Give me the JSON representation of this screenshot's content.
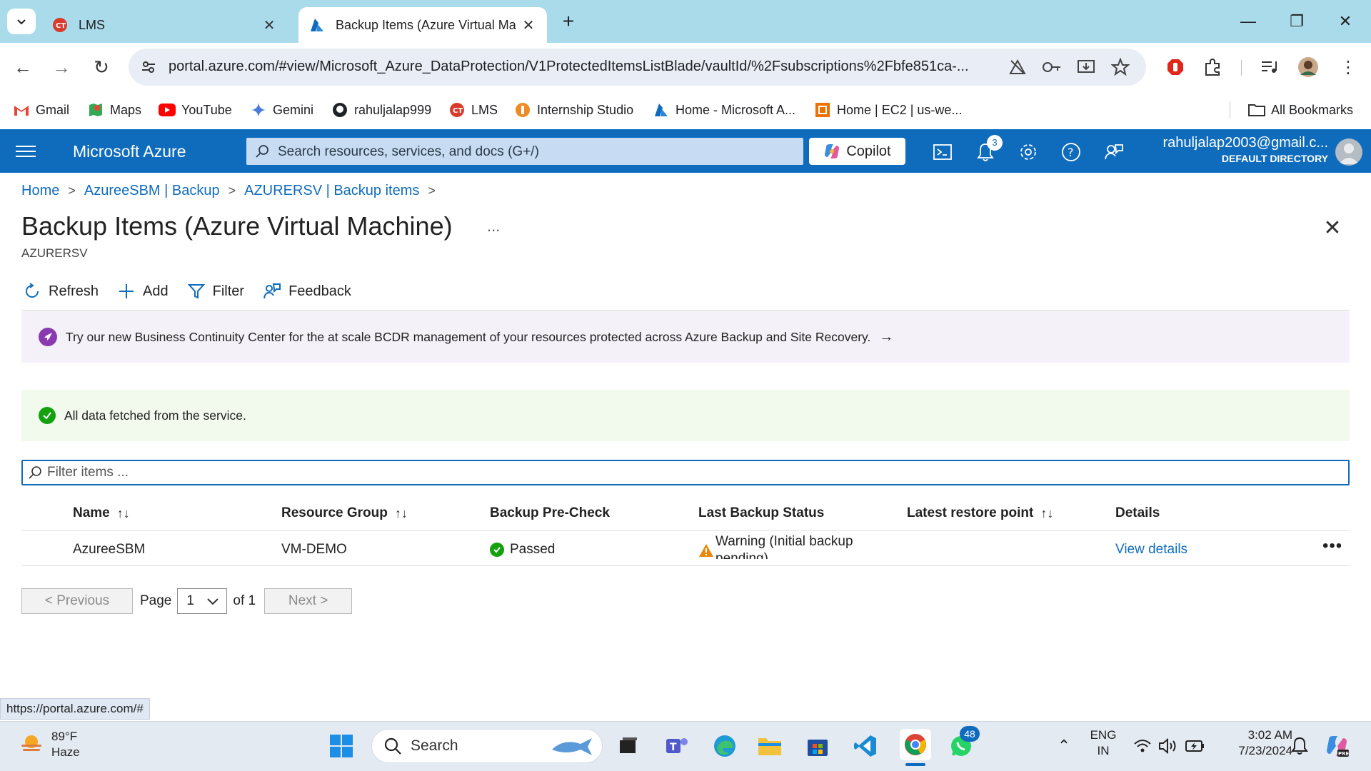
{
  "browser": {
    "tabs": [
      {
        "title": "LMS",
        "active": false
      },
      {
        "title": "Backup Items (Azure Virtual Ma",
        "active": true
      }
    ],
    "url": "portal.azure.com/#view/Microsoft_Azure_DataProtection/V1ProtectedItemsListBlade/vaultId/%2Fsubscriptions%2Fbfe851ca-...",
    "bookmarks": [
      {
        "label": "Gmail"
      },
      {
        "label": "Maps"
      },
      {
        "label": "YouTube"
      },
      {
        "label": "Gemini"
      },
      {
        "label": "rahuljalap999"
      },
      {
        "label": "LMS"
      },
      {
        "label": "Internship Studio"
      },
      {
        "label": "Home - Microsoft A..."
      },
      {
        "label": "Home | EC2 | us-we..."
      }
    ],
    "all_bookmarks": "All Bookmarks",
    "status_url": "https://portal.azure.com/#"
  },
  "azure": {
    "brand": "Microsoft Azure",
    "search_placeholder": "Search resources, services, and docs (G+/)",
    "copilot": "Copilot",
    "notification_count": "3",
    "account_email": "rahuljalap2003@gmail.c...",
    "account_directory": "DEFAULT DIRECTORY"
  },
  "breadcrumb": [
    "Home",
    "AzureeSBM | Backup",
    "AZURERSV | Backup items"
  ],
  "page": {
    "title": "Backup Items (Azure Virtual Machine)",
    "subtitle": "AZURERSV",
    "more": "...",
    "toolbar": {
      "refresh": "Refresh",
      "add": "Add",
      "filter": "Filter",
      "feedback": "Feedback"
    },
    "banner": "Try our new Business Continuity Center for the at scale BCDR management of your resources protected across Azure Backup and Site Recovery.",
    "success_message": "All data fetched from the service.",
    "filter_placeholder": "Filter items ..."
  },
  "table": {
    "columns": [
      "Name",
      "Resource Group",
      "Backup Pre-Check",
      "Last Backup Status",
      "Latest restore point",
      "Details"
    ],
    "rows": [
      {
        "name": "AzureeSBM",
        "resource_group": "VM-DEMO",
        "precheck": "Passed",
        "last_backup_status": "Warning (Initial backup pending)",
        "latest_restore_point": "",
        "details": "View details"
      }
    ]
  },
  "pager": {
    "previous": "< Previous",
    "page_label": "Page",
    "current": "1",
    "of": "of 1",
    "next": "Next >"
  },
  "taskbar": {
    "temperature": "89°F",
    "condition": "Haze",
    "search": "Search",
    "whatsapp_badge": "48",
    "lang1": "ENG",
    "lang2": "IN",
    "time": "3:02 AM",
    "date": "7/23/2024"
  },
  "colors": {
    "azure_blue": "#0f6cbd",
    "tab_strip": "#a9dbeb",
    "success_green": "#13a10e",
    "warning_orange": "#e8890c"
  }
}
